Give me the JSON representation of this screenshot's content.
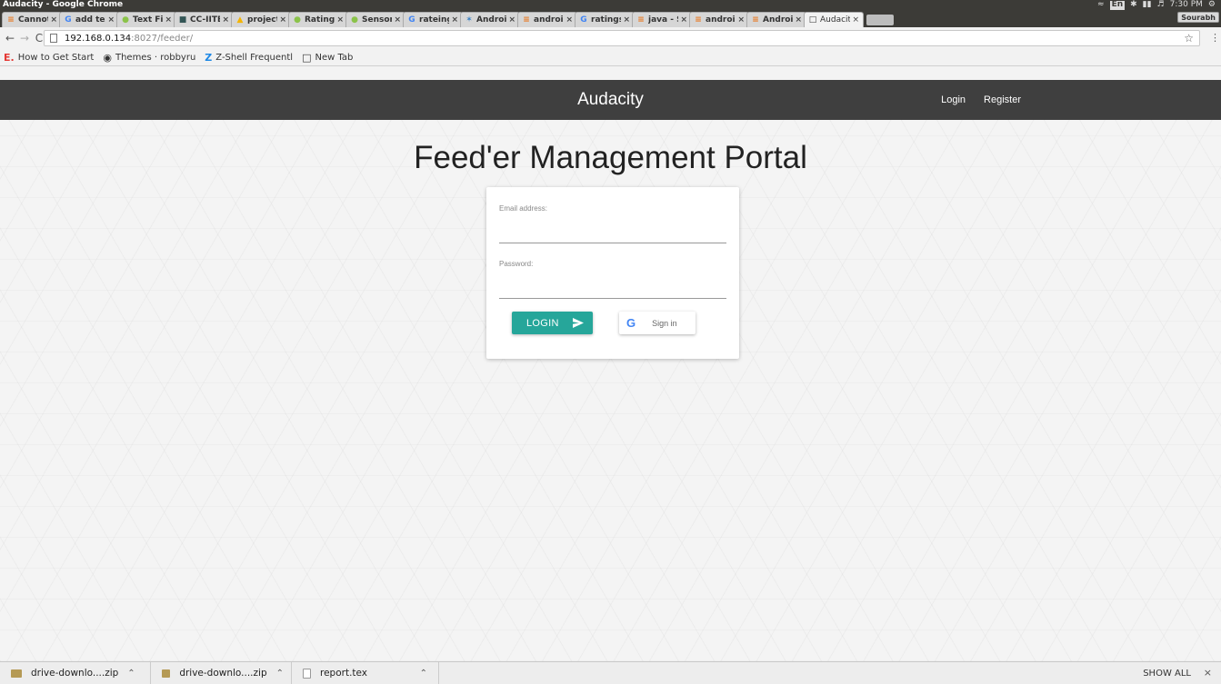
{
  "os": {
    "window_title": "Audacity - Google Chrome",
    "lang": "En",
    "time": "7:30 PM"
  },
  "tabs": [
    {
      "title": "Cannot s",
      "icon": "stackoverflow-icon"
    },
    {
      "title": "add text",
      "icon": "google-icon"
    },
    {
      "title": "Text Fiel",
      "icon": "android-icon"
    },
    {
      "title": "CC-IITB I",
      "icon": "building-icon"
    },
    {
      "title": "project -",
      "icon": "drive-icon"
    },
    {
      "title": "RatingB",
      "icon": "android-icon"
    },
    {
      "title": "Sensor |",
      "icon": "android-icon"
    },
    {
      "title": "rateing",
      "icon": "google-icon"
    },
    {
      "title": "Android",
      "icon": "gear-icon"
    },
    {
      "title": "android",
      "icon": "stackoverflow-icon"
    },
    {
      "title": "ratings",
      "icon": "google-icon"
    },
    {
      "title": "java - Se",
      "icon": "stackoverflow-icon"
    },
    {
      "title": "android",
      "icon": "stackoverflow-icon"
    },
    {
      "title": "Android",
      "icon": "stackoverflow-icon"
    },
    {
      "title": "Audacity",
      "icon": "page-icon",
      "active": true
    }
  ],
  "profile": "Sourabh",
  "address": {
    "host": "192.168.0.134",
    "path": ":8027/feeder/"
  },
  "bookmarks": [
    {
      "label": "How to Get Start",
      "icon": "E."
    },
    {
      "label": "Themes · robbyru",
      "icon": "github-icon"
    },
    {
      "label": "Z-Shell Frequentl",
      "icon": "Z"
    },
    {
      "label": "New Tab",
      "icon": "page-icon"
    }
  ],
  "site": {
    "brand": "Audacity",
    "nav": {
      "login": "Login",
      "register": "Register"
    },
    "title": "Feed'er Management Portal",
    "form": {
      "email_label": "Email address:",
      "email_value": "",
      "password_label": "Password:",
      "password_value": "",
      "login_button": "LOGIN",
      "google_button": "Sign in",
      "google_glyph": "G"
    },
    "colors": {
      "accent": "#26a69a",
      "header": "#3f3f3f"
    }
  },
  "downloads": {
    "items": [
      {
        "name": "drive-downlo....zip"
      },
      {
        "name": "drive-downlo....zip"
      },
      {
        "name": "report.tex"
      }
    ],
    "show_all": "SHOW ALL"
  }
}
